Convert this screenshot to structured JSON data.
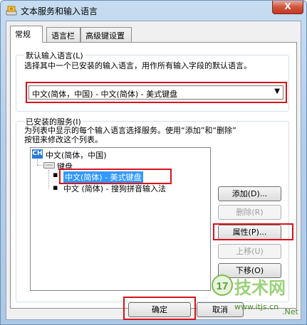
{
  "window": {
    "title": "文本服务和输入语言",
    "close_glyph": "X"
  },
  "tabs": [
    {
      "label": "常规"
    },
    {
      "label": "语言栏"
    },
    {
      "label": "高级键设置"
    }
  ],
  "default_lang": {
    "group_label": "默认输入语言(L)",
    "description": "选择其中一个已安装的输入语言，用作所有输入字段的默认语言。",
    "selected_value": "中文(简体，中国) - 中文(简体) - 美式键盘"
  },
  "installed": {
    "group_label": "已安装的服务(I)",
    "description_line1": "为列表中显示的每个输入语言选择服务。使用“添加”和“删除”",
    "description_line2": "按钮来修改这个列表。",
    "tree": {
      "lang_badge": "CH",
      "lang_label": "中文(简体，中国)",
      "keyboard_label": "键盘",
      "items": [
        {
          "label": "中文(简体) - 美式键盘",
          "selected": true
        },
        {
          "label": "中文 (简体) - 搜狗拼音输入法",
          "selected": false
        }
      ]
    },
    "buttons": {
      "add": "添加(D)...",
      "remove": "删除(R)",
      "properties": "属性(P)...",
      "move_up": "上移(U)",
      "move_down": "下移(O)"
    }
  },
  "footer": {
    "ok": "确定",
    "cancel": "取消"
  },
  "watermark": {
    "brand": "技术网",
    "url": "www.itjs.cn",
    "suffix": ".Net"
  }
}
